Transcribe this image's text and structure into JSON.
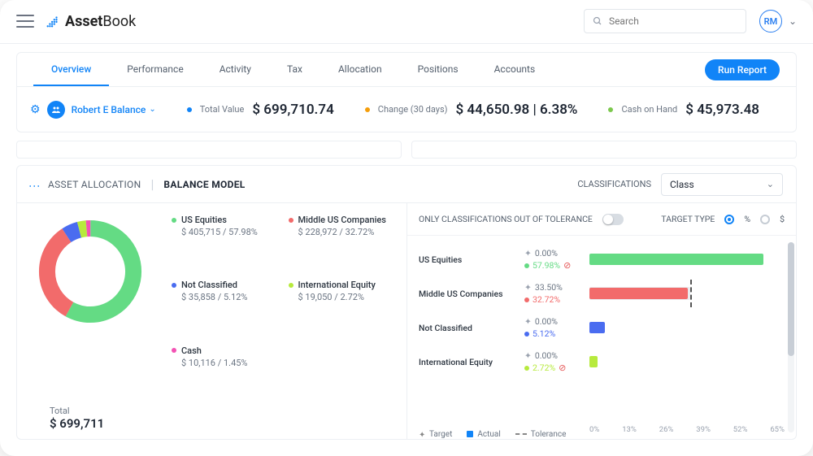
{
  "brand": {
    "name_a": "Asset",
    "name_b": "Book"
  },
  "search": {
    "placeholder": "Search"
  },
  "user": {
    "initials": "RM"
  },
  "tabs": [
    {
      "label": "Overview",
      "active": true
    },
    {
      "label": "Performance",
      "active": false
    },
    {
      "label": "Activity",
      "active": false
    },
    {
      "label": "Tax",
      "active": false
    },
    {
      "label": "Allocation",
      "active": false
    },
    {
      "label": "Positions",
      "active": false
    },
    {
      "label": "Accounts",
      "active": false
    }
  ],
  "run_report_label": "Run Report",
  "client": {
    "name": "Robert E Balance"
  },
  "summary": {
    "total_label": "Total Value",
    "total_value": "$ 699,710.74",
    "change_label": "Change (30 days)",
    "change_value": "$ 44,650.98 | 6.38%",
    "cash_label": "Cash on Hand",
    "cash_value": "$ 45,973.48"
  },
  "card": {
    "title": "ASSET ALLOCATION",
    "subtitle": "BALANCE MODEL",
    "classifications_label": "CLASSIFICATIONS",
    "classifications_value": "Class",
    "total_label": "Total",
    "total_value": "$ 699,711"
  },
  "right_panel": {
    "tolerance_label": "ONLY CLASSIFICATIONS OUT OF TOLERANCE",
    "target_type_label": "TARGET TYPE",
    "type_pct": "%",
    "type_dollar": "$",
    "legend_target": "Target",
    "legend_actual": "Actual",
    "legend_tolerance": "Tolerance"
  },
  "chart_data": {
    "type": "donut+bar",
    "total": 699711,
    "series": [
      {
        "name": "US Equities",
        "color": "#64db84",
        "value": 405715,
        "pct": 57.98,
        "target_pct": 0.0,
        "out_of_tolerance": true
      },
      {
        "name": "Middle US Companies",
        "color": "#f26b6b",
        "value": 228972,
        "pct": 32.72,
        "target_pct": 33.5,
        "out_of_tolerance": false
      },
      {
        "name": "Not Classified",
        "color": "#4a6cf0",
        "value": 35858,
        "pct": 5.12,
        "target_pct": 0.0,
        "out_of_tolerance": false
      },
      {
        "name": "International Equity",
        "color": "#b7ea3d",
        "value": 19050,
        "pct": 2.72,
        "target_pct": 0.0,
        "out_of_tolerance": true
      },
      {
        "name": "Cash",
        "color": "#f352b4",
        "value": 10116,
        "pct": 1.45,
        "target_pct": null,
        "out_of_tolerance": false
      }
    ],
    "axis_ticks": [
      "0%",
      "13%",
      "26%",
      "39%",
      "52%",
      "65%"
    ],
    "axis_max": 65
  }
}
